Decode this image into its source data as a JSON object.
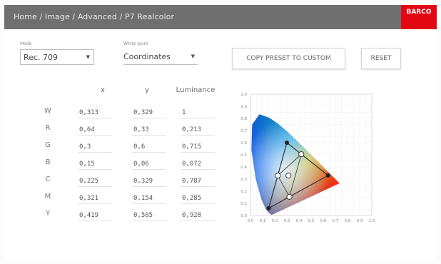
{
  "header": {
    "breadcrumb": "Home / Image / Advanced / P7 Realcolor",
    "logo": "BARCO"
  },
  "mode": {
    "label": "Mode",
    "value": "Rec. 709"
  },
  "white_point": {
    "label": "White point",
    "value": "Coordinates"
  },
  "buttons": {
    "copy": "COPY PRESET TO CUSTOM",
    "reset": "RESET"
  },
  "table": {
    "columns": [
      "x",
      "y",
      "Luminance"
    ],
    "rows": [
      {
        "label": "W",
        "x": "0,313",
        "y": "0,329",
        "lum": "1"
      },
      {
        "label": "R",
        "x": "0,64",
        "y": "0,33",
        "lum": "0,213"
      },
      {
        "label": "G",
        "x": "0,3",
        "y": "0,6",
        "lum": "0,715"
      },
      {
        "label": "B",
        "x": "0,15",
        "y": "0,06",
        "lum": "0,072"
      },
      {
        "label": "C",
        "x": "0,225",
        "y": "0,329",
        "lum": "0,787"
      },
      {
        "label": "M",
        "x": "0,321",
        "y": "0,154",
        "lum": "0,285"
      },
      {
        "label": "Y",
        "x": "0,419",
        "y": "0,505",
        "lum": "0,928"
      }
    ]
  },
  "chart_data": {
    "type": "scatter",
    "x_ticks": [
      "0.0",
      "0.1",
      "0.2",
      "0.3",
      "0.4",
      "0.5",
      "0.6",
      "0.7",
      "0.8",
      "0.9",
      "1.0"
    ],
    "y_ticks": [
      "1.0",
      "0.9",
      "0.8",
      "0.7",
      "0.6",
      "0.5",
      "0.4",
      "0.3",
      "0.2",
      "0.1",
      "0.0"
    ],
    "xlim": [
      0,
      1
    ],
    "ylim": [
      0,
      1
    ],
    "grid": true,
    "gamut": [
      [
        0.64,
        0.33
      ],
      [
        0.3,
        0.6
      ],
      [
        0.15,
        0.06
      ]
    ],
    "points": [
      {
        "name": "W",
        "x": 0.313,
        "y": 0.329
      },
      {
        "name": "R",
        "x": 0.64,
        "y": 0.33
      },
      {
        "name": "G",
        "x": 0.3,
        "y": 0.6
      },
      {
        "name": "B",
        "x": 0.15,
        "y": 0.06
      },
      {
        "name": "C",
        "x": 0.225,
        "y": 0.329
      },
      {
        "name": "M",
        "x": 0.321,
        "y": 0.154
      },
      {
        "name": "Y",
        "x": 0.419,
        "y": 0.505
      }
    ]
  }
}
